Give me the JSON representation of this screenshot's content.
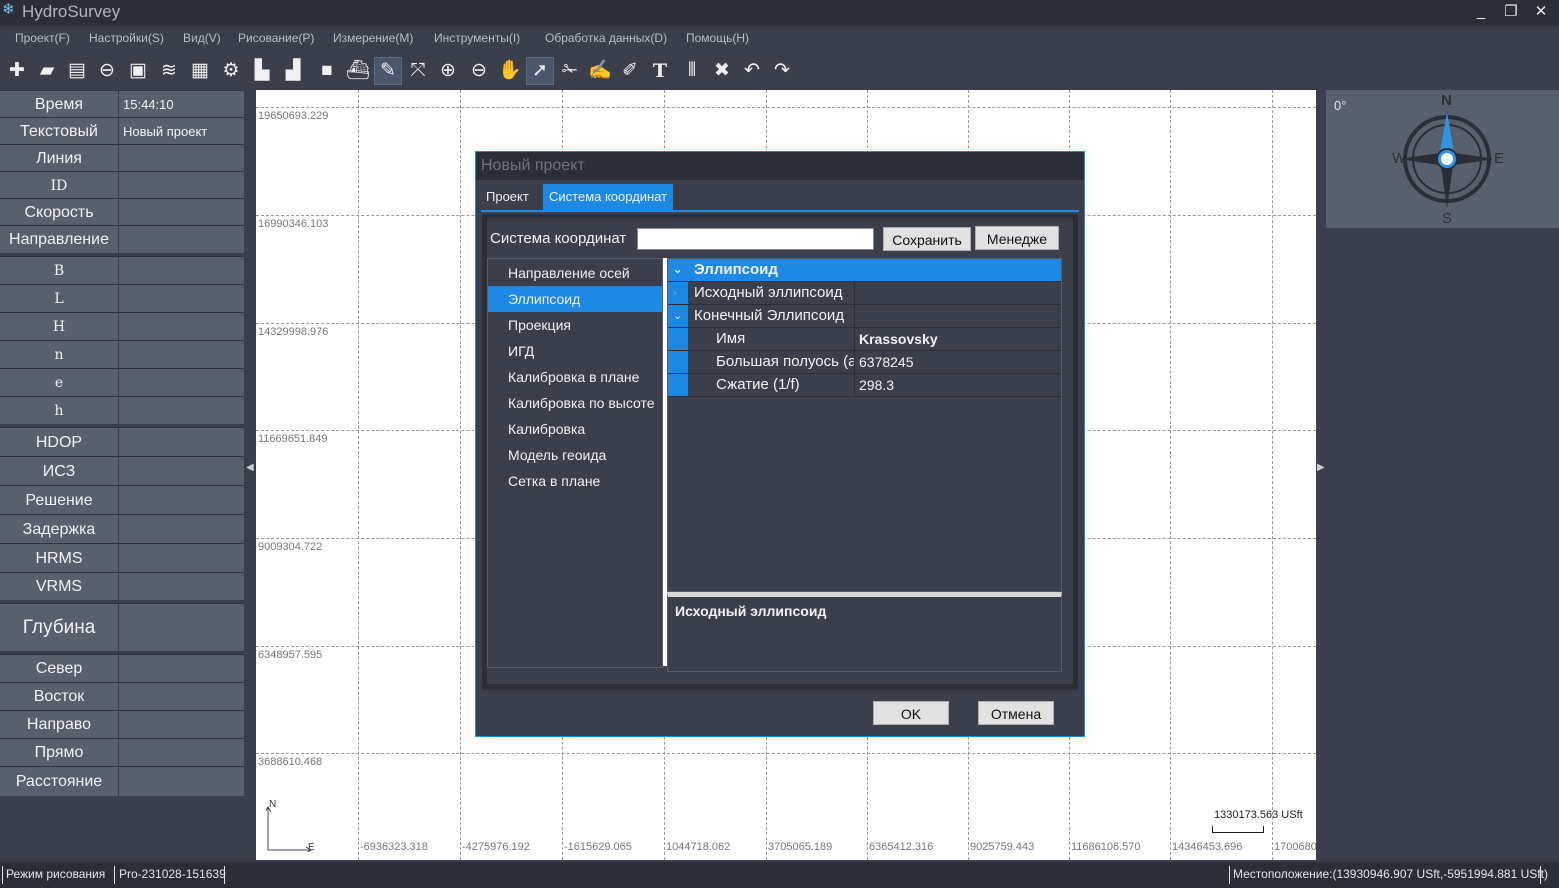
{
  "app": {
    "title": "HydroSurvey",
    "window_controls": [
      "_",
      "❐",
      "✕"
    ]
  },
  "menu": [
    "Проект(F)",
    "Настройки(S)",
    "Вид(V)",
    "Рисование(P)",
    "Измерение(M)",
    "Инструменты(I)",
    "Обработка данных(D)",
    "Помощь(H)"
  ],
  "toolbar_icons": [
    "new-project-icon",
    "open-folder-icon",
    "save-icon",
    "link-icon",
    "image-icon",
    "water-level-icon",
    "export-icon",
    "settings-icon",
    "print-icon",
    "stamp-icon",
    "video-icon",
    "boat-icon",
    "edit-icon",
    "fit-extent-icon",
    "zoom-in-icon",
    "zoom-out-icon",
    "pan-hand-icon",
    "pointer-icon",
    "measure-icon",
    "edit-point-icon",
    "edit-line-icon",
    "text-icon",
    "barcode-icon",
    "delete-icon",
    "undo-icon",
    "redo-icon"
  ],
  "left_panel": [
    {
      "label": "Время",
      "value": "15:44:10"
    },
    {
      "label": "Текстовый",
      "value": "Новый проект"
    },
    {
      "label": "Линия",
      "value": ""
    },
    {
      "label": "ID",
      "value": ""
    },
    {
      "label": "Скорость",
      "value": ""
    },
    {
      "label": "Направление",
      "value": ""
    },
    {
      "label": "B",
      "value": ""
    },
    {
      "label": "L",
      "value": ""
    },
    {
      "label": "H",
      "value": ""
    },
    {
      "label": "n",
      "value": ""
    },
    {
      "label": "e",
      "value": ""
    },
    {
      "label": "h",
      "value": ""
    },
    {
      "label": "HDOP",
      "value": ""
    },
    {
      "label": "ИСЗ",
      "value": ""
    },
    {
      "label": "Решение",
      "value": ""
    },
    {
      "label": "Задержка",
      "value": ""
    },
    {
      "label": "HRMS",
      "value": ""
    },
    {
      "label": "VRMS",
      "value": ""
    },
    {
      "label": "Глубина",
      "value": ""
    },
    {
      "label": "Север",
      "value": ""
    },
    {
      "label": "Восток",
      "value": ""
    },
    {
      "label": "Направо",
      "value": ""
    },
    {
      "label": "Прямо",
      "value": ""
    },
    {
      "label": "Расстояние",
      "value": ""
    }
  ],
  "map": {
    "y_labels": [
      "19650693.229",
      "16990346.103",
      "14329998.976",
      "11669651.849",
      "9009304.722",
      "6348957.595",
      "3688610.468"
    ],
    "x_labels": [
      "-6936323.318",
      "-4275976.192",
      "-1615629.065",
      "1044718.062",
      "3705065.189",
      "6365412.316",
      "9025759.443",
      "11686106.570",
      "14346453.696",
      "1700680"
    ],
    "north_label": "N",
    "east_label": "E",
    "scale_text": "1330173.563 USft"
  },
  "compass": {
    "heading": "0°",
    "n": "N",
    "s": "S",
    "e": "E",
    "w": "W"
  },
  "dialog": {
    "title": "Новый проект",
    "tabs": [
      "Проект",
      "Система координат"
    ],
    "cs_label": "Система координат",
    "cs_value": "",
    "save_button": "Сохранить",
    "manager_button": "Менедже",
    "nav": [
      "Направление осей",
      "Эллипсоид",
      "Проекция",
      "ИГД",
      "Калибровка в плане",
      "Калибровка по высоте",
      "Калибровка",
      "Модель геоида",
      "Сетка в плане"
    ],
    "props": {
      "group": "Эллипсоид",
      "source": "Исходный эллипсоид",
      "target": "Конечный Эллипсоид",
      "fields": [
        {
          "key": "Имя",
          "value": "Krassovsky"
        },
        {
          "key": "Большая полуось (а",
          "value": "6378245"
        },
        {
          "key": "Сжатие (1/f)",
          "value": "298.3"
        }
      ]
    },
    "description_title": "Исходный эллипсоид",
    "ok_button": "OK",
    "cancel_button": "Отмена"
  },
  "status": {
    "mode": "Режим рисования",
    "version": "Pro-231028-151639",
    "location": "Местоположение:(13930946.907 USft,-5951994.881 USft)"
  }
}
